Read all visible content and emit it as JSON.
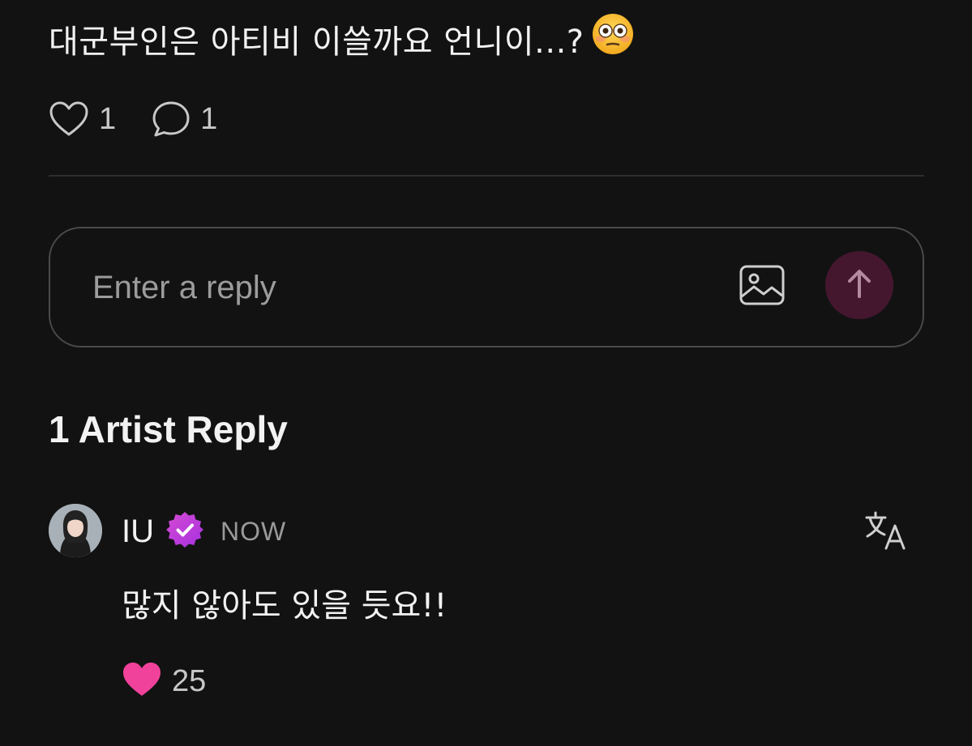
{
  "post": {
    "text": "대군부인은 아티비 이쓸까요 언니이...?",
    "emoji": "flushed-face-emoji",
    "like_count": "1",
    "comment_count": "1"
  },
  "reply_composer": {
    "placeholder": "Enter a reply",
    "image_icon": "image-icon",
    "send_icon": "arrow-up-icon",
    "send_color": "#44172f"
  },
  "section": {
    "title": "1 Artist Reply"
  },
  "artist_reply": {
    "author": "IU",
    "verified_badge_color": "#c13fd8",
    "timestamp": "NOW",
    "translate_icon": "translate-icon",
    "text": "많지 않아도 있을 듯요!!",
    "like_count": "25",
    "like_color": "#f1429b"
  }
}
